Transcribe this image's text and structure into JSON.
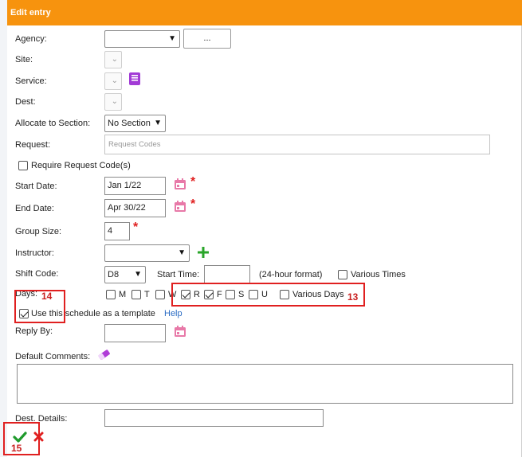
{
  "header": {
    "title": "Edit entry"
  },
  "form": {
    "agency": {
      "label": "Agency:",
      "value": "",
      "browse_label": "..."
    },
    "site": {
      "label": "Site:"
    },
    "service": {
      "label": "Service:"
    },
    "dest": {
      "label": "Dest:"
    },
    "allocate": {
      "label": "Allocate to Section:",
      "value": "No Section"
    },
    "request": {
      "label": "Request:",
      "placeholder": "Request Codes"
    },
    "require_codes": {
      "label": "Require Request Code(s)",
      "checked": false
    },
    "start_date": {
      "label": "Start Date:",
      "value": "Jan 1/22"
    },
    "end_date": {
      "label": "End Date:",
      "value": "Apr 30/22"
    },
    "group_size": {
      "label": "Group Size:",
      "value": "4"
    },
    "required_mark": "*",
    "instructor": {
      "label": "Instructor:",
      "value": ""
    },
    "shift_code": {
      "label": "Shift Code:",
      "value": "D8"
    },
    "start_time": {
      "label": "Start Time:",
      "value": "",
      "hint": "(24-hour format)"
    },
    "various_times": {
      "label": "Various Times",
      "checked": false
    },
    "days": {
      "label": "Days:",
      "items": [
        {
          "label": "M",
          "checked": false
        },
        {
          "label": "T",
          "checked": false
        },
        {
          "label": "W",
          "checked": false
        },
        {
          "label": "R",
          "checked": true
        },
        {
          "label": "F",
          "checked": true
        },
        {
          "label": "S",
          "checked": false
        },
        {
          "label": "U",
          "checked": false
        }
      ],
      "various_days": {
        "label": "Various Days",
        "checked": false
      }
    },
    "template": {
      "label": "Use this schedule as a template",
      "checked": true,
      "help": "Help"
    },
    "reply_by": {
      "label": "Reply By:",
      "value": ""
    },
    "default_comments": {
      "label": "Default Comments:"
    },
    "dest_details": {
      "label": "Dest. Details:",
      "value": ""
    }
  },
  "annotations": {
    "days_box": "13",
    "template_box": "14",
    "actions_box": "15"
  },
  "colors": {
    "header": "#f7930e",
    "accent_pink": "#e879a8",
    "service_icon": "#a23bd6",
    "add_green": "#2aa52a",
    "confirm_green": "#1f9a2c",
    "cancel_red": "#e02020",
    "annotation_red": "#e02020"
  },
  "icons": {
    "calendar": "calendar-icon",
    "book": "book-icon",
    "eraser": "eraser-icon",
    "plus": "add-icon",
    "check": "check-icon",
    "close": "close-icon"
  }
}
